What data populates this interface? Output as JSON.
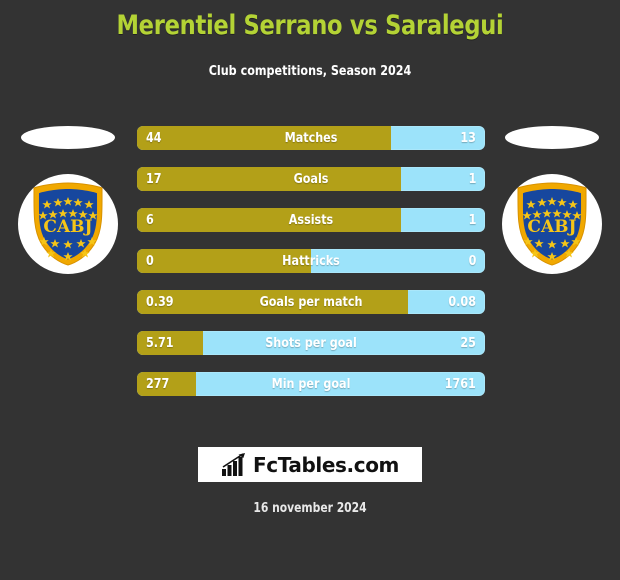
{
  "header": {
    "title": "Merentiel Serrano vs Saralegui",
    "subtitle": "Club competitions, Season 2024",
    "title_color": "#b4d335"
  },
  "teams": {
    "home": {
      "crest_name": "CABJ",
      "crest_text": "CABJ"
    },
    "away": {
      "crest_name": "CABJ",
      "crest_text": "CABJ"
    }
  },
  "colors": {
    "background": "#333333",
    "home_bar": "#b3a018",
    "away_bar": "#9ce3fa",
    "text": "#ffffff",
    "accent": "#b4d335"
  },
  "chart_data": {
    "type": "bar",
    "title": "Merentiel Serrano vs Saralegui",
    "subtitle": "Club competitions, Season 2024",
    "orientation": "horizontal-diverging",
    "legend_position": "none",
    "series": [
      {
        "name": "Merentiel Serrano",
        "color": "#b3a018",
        "values": [
          44,
          17,
          6,
          0,
          0.39,
          5.71,
          277
        ]
      },
      {
        "name": "Saralegui",
        "color": "#9ce3fa",
        "values": [
          13,
          1,
          1,
          0,
          0.08,
          25,
          1761
        ]
      }
    ],
    "categories": [
      "Matches",
      "Goals",
      "Assists",
      "Hattricks",
      "Goals per match",
      "Shots per goal",
      "Min per goal"
    ]
  },
  "stats": {
    "rows": [
      {
        "label": "Matches",
        "home": "44",
        "away": "13",
        "home_pct": 73
      },
      {
        "label": "Goals",
        "home": "17",
        "away": "1",
        "home_pct": 76
      },
      {
        "label": "Assists",
        "home": "6",
        "away": "1",
        "home_pct": 76
      },
      {
        "label": "Hattricks",
        "home": "0",
        "away": "0",
        "home_pct": 50
      },
      {
        "label": "Goals per match",
        "home": "0.39",
        "away": "0.08",
        "home_pct": 78
      },
      {
        "label": "Shots per goal",
        "home": "5.71",
        "away": "25",
        "home_pct": 19
      },
      {
        "label": "Min per goal",
        "home": "277",
        "away": "1761",
        "home_pct": 17
      }
    ]
  },
  "footer": {
    "logo_text": "FcTables.com",
    "logo_icon": "bar-chart-growth-icon",
    "date": "16 november 2024"
  }
}
